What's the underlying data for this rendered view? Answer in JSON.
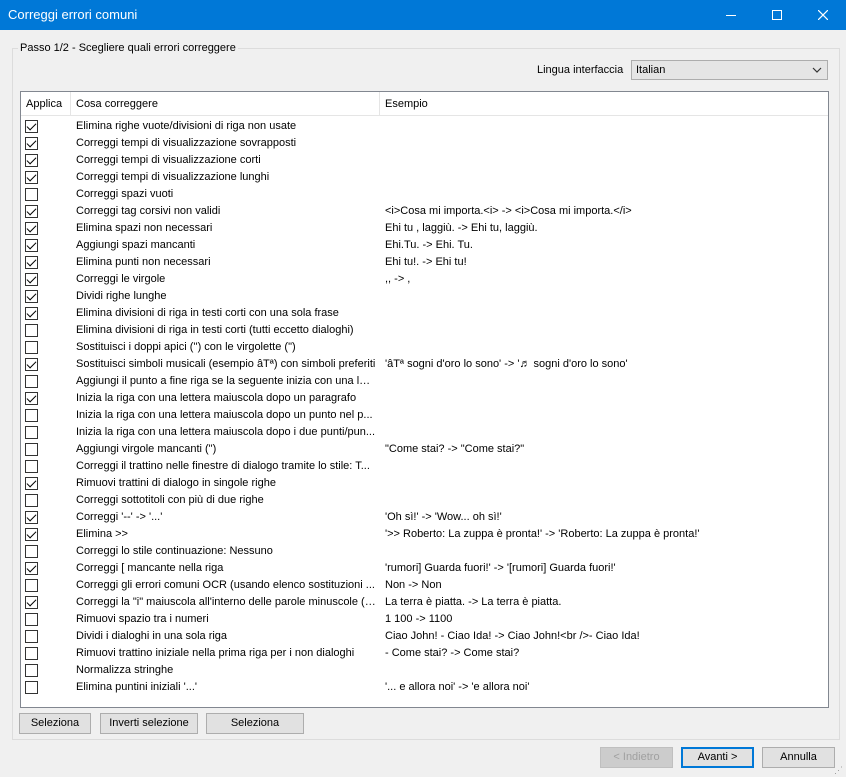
{
  "window": {
    "title": "Correggi errori comuni"
  },
  "step_label": "Passo 1/2 - Scegliere quali errori correggere",
  "language": {
    "label": "Lingua interfaccia",
    "value": "Italian"
  },
  "columns": {
    "apply": "Applica",
    "what": "Cosa correggere",
    "example": "Esempio"
  },
  "rows": [
    {
      "checked": true,
      "what": "Elimina righe vuote/divisioni di riga non usate",
      "example": ""
    },
    {
      "checked": true,
      "what": "Correggi tempi di visualizzazione sovrapposti",
      "example": ""
    },
    {
      "checked": true,
      "what": "Correggi tempi di visualizzazione corti",
      "example": ""
    },
    {
      "checked": true,
      "what": "Correggi tempi di visualizzazione lunghi",
      "example": ""
    },
    {
      "checked": false,
      "what": "Correggi spazi vuoti",
      "example": ""
    },
    {
      "checked": true,
      "what": "Correggi tag corsivi non validi",
      "example": "<i>Cosa mi importa.<i> -> <i>Cosa mi importa.</i>"
    },
    {
      "checked": true,
      "what": "Elimina spazi non necessari",
      "example": "Ehi   tu , laggiù. -> Ehi tu, laggiù."
    },
    {
      "checked": true,
      "what": "Aggiungi spazi mancanti",
      "example": "Ehi.Tu. -> Ehi. Tu."
    },
    {
      "checked": true,
      "what": "Elimina punti non necessari",
      "example": "Ehi tu!. -> Ehi tu!"
    },
    {
      "checked": true,
      "what": "Correggi le virgole",
      "example": ",, -> ,"
    },
    {
      "checked": true,
      "what": "Dividi righe lunghe",
      "example": ""
    },
    {
      "checked": true,
      "what": "Elimina divisioni di riga in testi corti con una sola frase",
      "example": ""
    },
    {
      "checked": false,
      "what": "Elimina divisioni di riga in testi corti (tutti eccetto dialoghi)",
      "example": ""
    },
    {
      "checked": false,
      "what": "Sostituisci i doppi apici ('') con le virgolette (\")",
      "example": ""
    },
    {
      "checked": true,
      "what": "Sostituisci simboli musicali (esempio âTª) con simboli preferiti",
      "example": "'âTª sogni d'oro lo sono' -> '♬ sogni d'oro lo sono'"
    },
    {
      "checked": false,
      "what": "Aggiungi il punto a fine riga se la seguente inizia con una let...",
      "example": ""
    },
    {
      "checked": true,
      "what": "Inizia la riga con una lettera maiuscola dopo un paragrafo",
      "example": ""
    },
    {
      "checked": false,
      "what": "Inizia la riga con una lettera maiuscola dopo un punto nel p...",
      "example": ""
    },
    {
      "checked": false,
      "what": "Inizia la riga con una lettera maiuscola dopo i due punti/pun...",
      "example": ""
    },
    {
      "checked": false,
      "what": "Aggiungi virgole mancanti (\")",
      "example": "\"Come stai? -> \"Come stai?\""
    },
    {
      "checked": false,
      "what": "Correggi il trattino nelle finestre di dialogo tramite lo stile: T...",
      "example": ""
    },
    {
      "checked": true,
      "what": "Rimuovi trattini di dialogo in singole righe",
      "example": ""
    },
    {
      "checked": false,
      "what": "Correggi sottotitoli con più di due righe",
      "example": ""
    },
    {
      "checked": true,
      "what": "Correggi '--' -> '...'",
      "example": "'Oh sì!' -> 'Wow... oh sì!'"
    },
    {
      "checked": true,
      "what": "Elimina >>",
      "example": "'>> Roberto: La zuppa è pronta!' -> 'Roberto: La zuppa è pronta!'"
    },
    {
      "checked": false,
      "what": "Correggi lo stile continuazione: Nessuno",
      "example": ""
    },
    {
      "checked": true,
      "what": "Correggi [ mancante nella riga",
      "example": "'rumori] Guarda fuori!' -> '[rumori] Guarda fuori!'"
    },
    {
      "checked": false,
      "what": "Correggi gli errori comuni OCR (usando elenco sostituzioni ...",
      "example": "Non -> Non"
    },
    {
      "checked": true,
      "what": "Correggi la \"i\" maiuscola all'interno delle parole minuscole (e...",
      "example": "La terra è piatta. -> La terra è piatta."
    },
    {
      "checked": false,
      "what": "Rimuovi spazio tra i numeri",
      "example": "1 100 -> 1100"
    },
    {
      "checked": false,
      "what": "Dividi i dialoghi in una sola riga",
      "example": "Ciao John! - Ciao Ida! -> Ciao John!<br />- Ciao Ida!"
    },
    {
      "checked": false,
      "what": "Rimuovi trattino iniziale nella prima riga per i non dialoghi",
      "example": "- Come stai? -> Come stai?"
    },
    {
      "checked": false,
      "what": "Normalizza stringhe",
      "example": ""
    },
    {
      "checked": false,
      "what": "Elimina puntini iniziali '...'",
      "example": "'... e allora noi' -> 'e allora noi'"
    }
  ],
  "buttons": {
    "select_all": "Seleziona",
    "invert": "Inverti selezione",
    "select": "Seleziona",
    "back": "< Indietro",
    "next": "Avanti >",
    "cancel": "Annulla"
  }
}
